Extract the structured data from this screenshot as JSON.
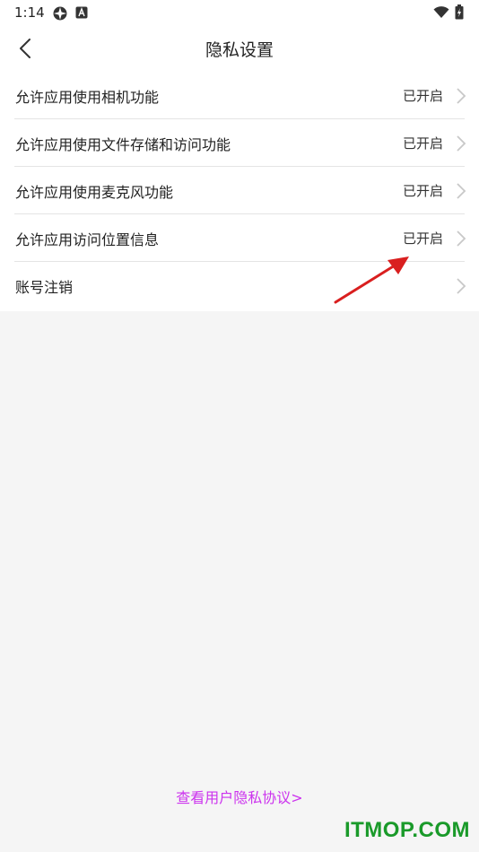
{
  "status_bar": {
    "time": "1:14"
  },
  "header": {
    "title": "隐私设置"
  },
  "settings": [
    {
      "label": "允许应用使用相机功能",
      "status": "已开启"
    },
    {
      "label": "允许应用使用文件存储和访问功能",
      "status": "已开启"
    },
    {
      "label": "允许应用使用麦克风功能",
      "status": "已开启"
    },
    {
      "label": "允许应用访问位置信息",
      "status": "已开启"
    },
    {
      "label": "账号注销",
      "status": ""
    }
  ],
  "footer": {
    "privacy_link": "查看用户隐私协议>"
  },
  "watermark": "ITMOP.COM",
  "colors": {
    "link": "#cc33ee",
    "arrow": "#d91f1f",
    "watermark": "#1a9a2a"
  }
}
